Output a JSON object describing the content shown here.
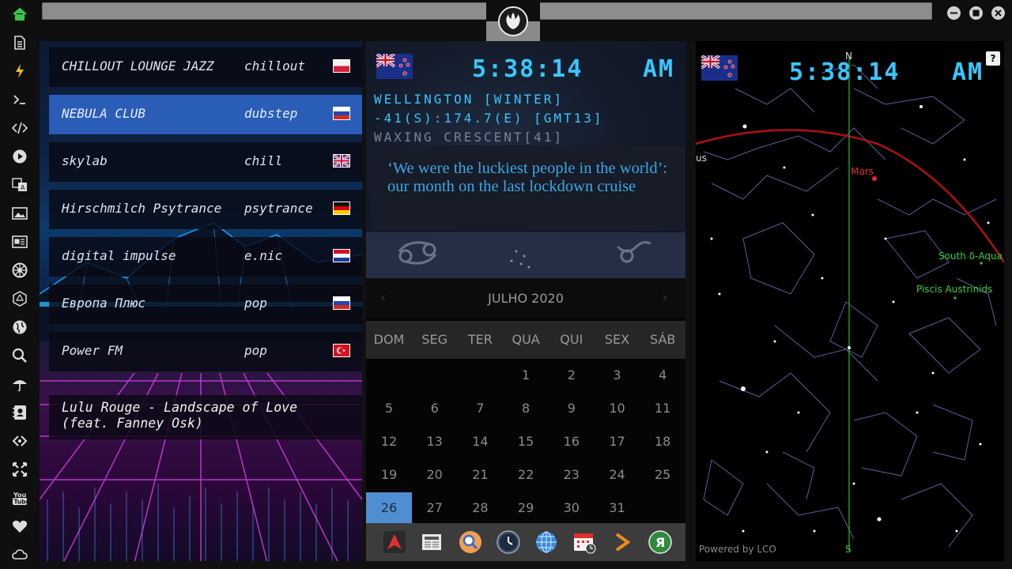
{
  "sidebar": {
    "items": [
      {
        "icon": "home-icon"
      },
      {
        "icon": "document-icon"
      },
      {
        "icon": "bolt-icon"
      },
      {
        "icon": "terminal-icon"
      },
      {
        "icon": "code-icon"
      },
      {
        "icon": "play-icon"
      },
      {
        "icon": "translate-icon"
      },
      {
        "icon": "image-icon"
      },
      {
        "icon": "news-icon"
      },
      {
        "icon": "empire-icon"
      },
      {
        "icon": "hexagon-icon"
      },
      {
        "icon": "globe-icon"
      },
      {
        "icon": "search-icon"
      },
      {
        "icon": "umbrella-icon"
      },
      {
        "icon": "contact-icon"
      },
      {
        "icon": "share-icon"
      },
      {
        "icon": "expand-icon"
      },
      {
        "icon": "youtube-icon"
      },
      {
        "icon": "heart-icon"
      },
      {
        "icon": "cloud-icon"
      }
    ]
  },
  "topbar": {
    "logo_icon": "rebel-alliance-icon"
  },
  "radio": {
    "stations": [
      {
        "name": "CHILLOUT LOUNGE JAZZ",
        "genre": "chillout",
        "flag": "poland"
      },
      {
        "name": "NEBULA CLUB",
        "genre": "dubstep",
        "flag": "russia",
        "active": true
      },
      {
        "name": "skylab",
        "genre": "chill",
        "flag": "uk"
      },
      {
        "name": "Hirschmilch Psytrance",
        "genre": "psytrance",
        "flag": "germany"
      },
      {
        "name": "digital impulse",
        "genre": "e.nic",
        "flag": "croatia"
      },
      {
        "name": "Европа Плюс",
        "genre": "pop",
        "flag": "russia"
      },
      {
        "name": "Power FM",
        "genre": "pop",
        "flag": "turkey"
      }
    ],
    "now_playing_line1": "Lulu Rouge - Landscape of Love",
    "now_playing_line2": "(feat. Fanney Osk)"
  },
  "clock": {
    "time": "5:38:14",
    "ampm": "AM",
    "location": "WELLINGTON [WINTER]",
    "coords": "-41(S):174.7(E) [GMT13]",
    "moon": "WAXING CRESCENT[41]",
    "flag": "new-zealand"
  },
  "news": {
    "headline": "‘We were the luckiest people in the world’: our month on the last lockdown cruise"
  },
  "calendar": {
    "title": "JULHO 2020",
    "day_names": [
      "DOM",
      "SEG",
      "TER",
      "QUA",
      "QUI",
      "SEX",
      "SÁB"
    ],
    "weeks": [
      [
        "",
        "",
        "",
        "1",
        "2",
        "3",
        "4"
      ],
      [
        "5",
        "6",
        "7",
        "8",
        "9",
        "10",
        "11"
      ],
      [
        "12",
        "13",
        "14",
        "15",
        "16",
        "17",
        "18"
      ],
      [
        "19",
        "20",
        "21",
        "22",
        "23",
        "24",
        "25"
      ],
      [
        "26",
        "27",
        "28",
        "29",
        "30",
        "31",
        ""
      ]
    ],
    "today": "26"
  },
  "dock": {
    "items": [
      "arch-icon",
      "news-app-icon",
      "search-app-icon",
      "clock-app-icon",
      "browser-icon",
      "calendar-app-icon",
      "forward-icon",
      "yandex-icon"
    ]
  },
  "sky": {
    "time": "5:38:14",
    "ampm": "AM",
    "north": "N",
    "south": "S",
    "help": "?",
    "labels": {
      "mars": "Mars",
      "south_aqua": "South δ-Aqua",
      "piscis": "Piscis Austrinids",
      "us": "us"
    },
    "powered": "Powered by LCO"
  },
  "colors": {
    "digital_blue": "#39c6ff",
    "active_station": "#2a5db8",
    "today_cell": "#4f8fd1",
    "ecliptic": "#b01010",
    "meridian": "#1fa21f"
  }
}
